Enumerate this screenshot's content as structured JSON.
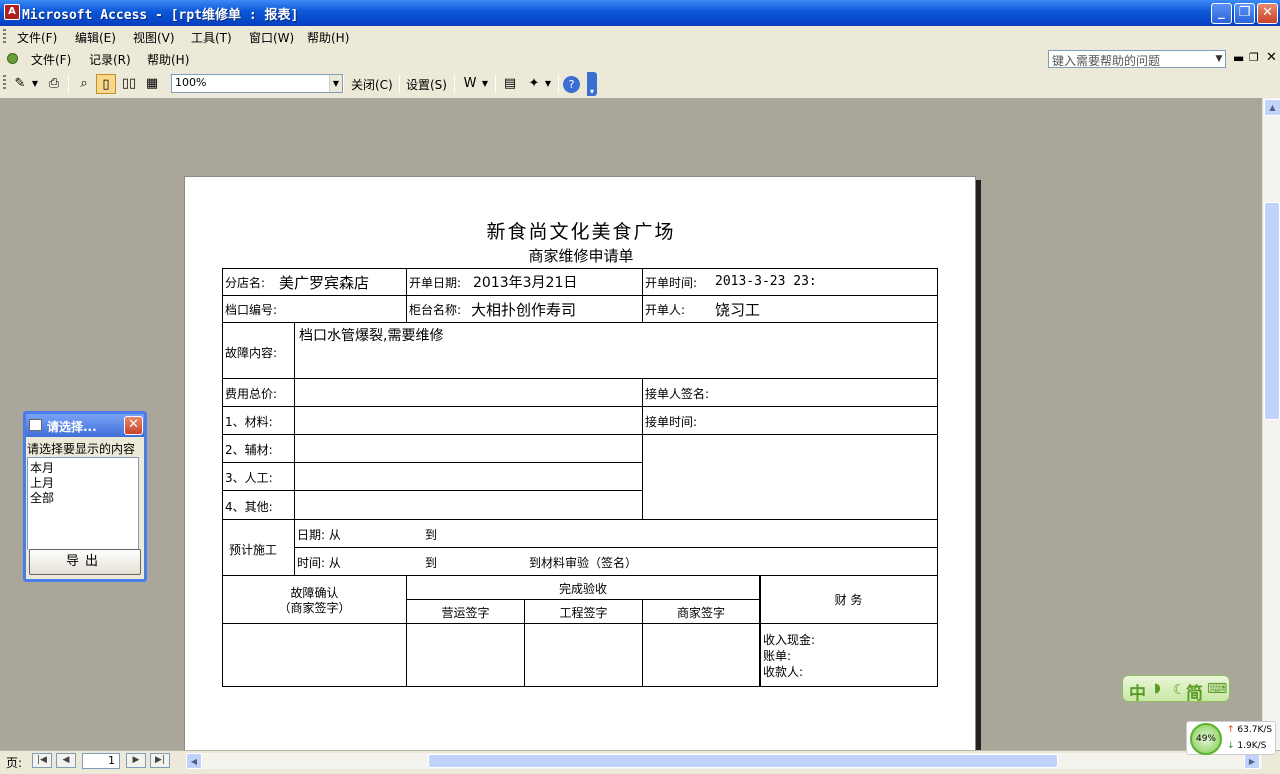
{
  "window": {
    "title": "Microsoft Access - [rpt维修单 : 报表]",
    "minimize": "_",
    "restore": "❐",
    "close": "✕"
  },
  "menu_main": [
    "文件(F)",
    "编辑(E)",
    "视图(V)",
    "工具(T)",
    "窗口(W)",
    "帮助(H)"
  ],
  "menu_report": [
    "文件(F)",
    "记录(R)",
    "帮助(H)"
  ],
  "help_box": {
    "placeholder": "键入需要帮助的问题"
  },
  "toolbar": {
    "zoom": "100%",
    "close_label": "关闭(C)",
    "setup_label": "设置(S)"
  },
  "report": {
    "title": "新食尚文化美食广场",
    "subtitle": "商家维修申请单",
    "labels": {
      "branch": "分店名:",
      "open_date": "开单日期:",
      "open_time": "开单时间:",
      "stall_no": "档口编号:",
      "counter_name": "柜台名称:",
      "opener": "开单人:",
      "fault": "故障内容:",
      "total_cost": "费用总价:",
      "receiver_sign": "接单人签名:",
      "material": "1、材料:",
      "receive_time": "接单时间:",
      "aux_material": "2、辅材:",
      "labor": "3、人工:",
      "other": "4、其他:",
      "plan": "预计施工",
      "date_from": "日期:  从",
      "date_to": "到",
      "time_from": "时间:  从",
      "time_to": "到",
      "material_check": "到材料审验（签名）",
      "fault_confirm": "故障确认",
      "merchant_sign_paren": "（商家签字）",
      "completion_check": "完成验收",
      "ops_sign": "营运签字",
      "eng_sign": "工程签字",
      "merchant_sign": "商家签字",
      "finance": "财  务",
      "cash": "收入现金:",
      "bill": "账单:",
      "payee": "收款人:"
    },
    "values": {
      "branch": "美广罗宾森店",
      "open_date": "2013年3月21日",
      "open_time": "2013-3-23 23:",
      "counter_name": "大相扑创作寿司",
      "opener": "饶习工",
      "fault": "档口水管爆裂,需要维修"
    }
  },
  "form": {
    "title": "请选择...",
    "label": "请选择要显示的内容",
    "options": [
      "本月",
      "上月",
      "全部"
    ],
    "export": "导出"
  },
  "nav": {
    "page_label": "页:",
    "page_number": "1"
  },
  "ime": {
    "chars": [
      "中",
      "简"
    ]
  },
  "net": {
    "percent": "49%",
    "up": "63.7K/S",
    "down": "1.9K/S"
  }
}
